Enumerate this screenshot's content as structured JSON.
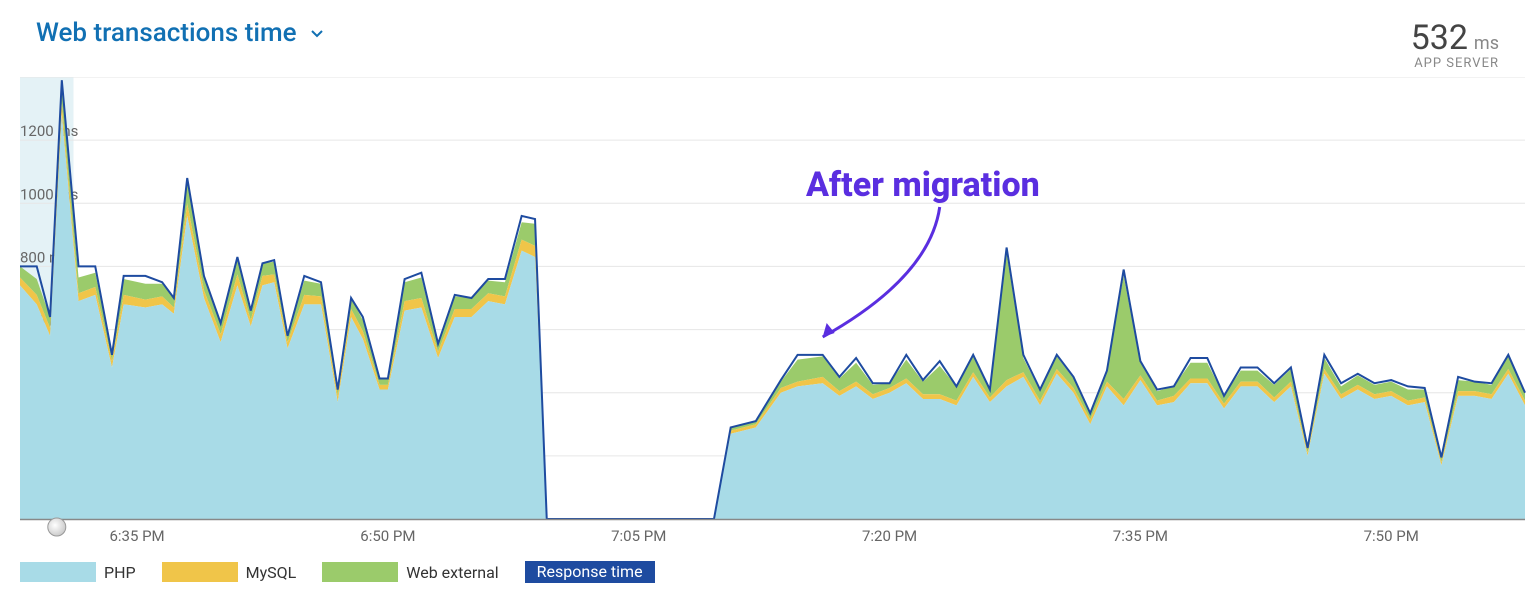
{
  "header": {
    "title": "Web transactions time",
    "metric_value": "532",
    "metric_unit": "ms",
    "metric_sub": "APP SERVER"
  },
  "annotation": {
    "text": "After migration"
  },
  "legend": {
    "php": "PHP",
    "mysql": "MySQL",
    "web": "Web external",
    "resp": "Response time"
  },
  "chart_data": {
    "type": "area",
    "title": "Web transactions time",
    "ylabel": "ms",
    "ylim": [
      0,
      1400
    ],
    "y_ticks": [
      200,
      400,
      600,
      800,
      1000,
      1200,
      1400
    ],
    "x_ticks": [
      "6:35 PM",
      "6:50 PM",
      "7:05 PM",
      "7:20 PM",
      "7:35 PM",
      "7:50 PM"
    ],
    "x_tick_minutes": [
      395,
      410,
      425,
      440,
      455,
      470
    ],
    "x_range_minutes": [
      388,
      478
    ],
    "annotation": {
      "text": "After migration",
      "at_minute": 445
    },
    "series": [
      {
        "name": "PHP",
        "color": "#a8dbe7"
      },
      {
        "name": "MySQL",
        "color": "#f0c549"
      },
      {
        "name": "Web external",
        "color": "#9bcb6b"
      },
      {
        "name": "Response time",
        "color": "#1e4ba0"
      }
    ],
    "points": [
      {
        "m": 388.0,
        "php": 740,
        "mysql": 25,
        "web": 35,
        "resp": 800
      },
      {
        "m": 389.0,
        "php": 680,
        "mysql": 30,
        "web": 50,
        "resp": 800
      },
      {
        "m": 389.8,
        "php": 580,
        "mysql": 25,
        "web": 35,
        "resp": 640
      },
      {
        "m": 390.5,
        "php": 1280,
        "mysql": 35,
        "web": 60,
        "resp": 1390
      },
      {
        "m": 391.5,
        "php": 690,
        "mysql": 25,
        "web": 50,
        "resp": 800
      },
      {
        "m": 392.5,
        "php": 710,
        "mysql": 25,
        "web": 45,
        "resp": 800
      },
      {
        "m": 393.5,
        "php": 480,
        "mysql": 20,
        "web": 25,
        "resp": 520
      },
      {
        "m": 394.2,
        "php": 680,
        "mysql": 30,
        "web": 50,
        "resp": 770
      },
      {
        "m": 395.5,
        "php": 670,
        "mysql": 25,
        "web": 50,
        "resp": 770
      },
      {
        "m": 396.5,
        "php": 680,
        "mysql": 25,
        "web": 40,
        "resp": 750
      },
      {
        "m": 397.2,
        "php": 650,
        "mysql": 20,
        "web": 30,
        "resp": 700
      },
      {
        "m": 398.0,
        "php": 960,
        "mysql": 40,
        "web": 65,
        "resp": 1080
      },
      {
        "m": 399.0,
        "php": 700,
        "mysql": 25,
        "web": 45,
        "resp": 770
      },
      {
        "m": 400.0,
        "php": 560,
        "mysql": 25,
        "web": 30,
        "resp": 620
      },
      {
        "m": 401.0,
        "php": 740,
        "mysql": 35,
        "web": 50,
        "resp": 830
      },
      {
        "m": 401.8,
        "php": 610,
        "mysql": 20,
        "web": 30,
        "resp": 660
      },
      {
        "m": 402.5,
        "php": 740,
        "mysql": 30,
        "web": 40,
        "resp": 810
      },
      {
        "m": 403.2,
        "php": 750,
        "mysql": 25,
        "web": 40,
        "resp": 820
      },
      {
        "m": 404.0,
        "php": 540,
        "mysql": 20,
        "web": 25,
        "resp": 580
      },
      {
        "m": 405.0,
        "php": 680,
        "mysql": 30,
        "web": 45,
        "resp": 770
      },
      {
        "m": 406.0,
        "php": 680,
        "mysql": 25,
        "web": 40,
        "resp": 750
      },
      {
        "m": 407.0,
        "php": 370,
        "mysql": 20,
        "web": 25,
        "resp": 410
      },
      {
        "m": 407.8,
        "php": 640,
        "mysql": 25,
        "web": 35,
        "resp": 700
      },
      {
        "m": 408.5,
        "php": 570,
        "mysql": 25,
        "web": 35,
        "resp": 640
      },
      {
        "m": 409.5,
        "php": 410,
        "mysql": 15,
        "web": 20,
        "resp": 445
      },
      {
        "m": 410.0,
        "php": 410,
        "mysql": 15,
        "web": 20,
        "resp": 445
      },
      {
        "m": 411.0,
        "php": 660,
        "mysql": 30,
        "web": 60,
        "resp": 760
      },
      {
        "m": 412.0,
        "php": 670,
        "mysql": 30,
        "web": 65,
        "resp": 780
      },
      {
        "m": 413.0,
        "php": 510,
        "mysql": 20,
        "web": 25,
        "resp": 555
      },
      {
        "m": 414.0,
        "php": 640,
        "mysql": 25,
        "web": 40,
        "resp": 710
      },
      {
        "m": 415.0,
        "php": 640,
        "mysql": 25,
        "web": 35,
        "resp": 700
      },
      {
        "m": 416.0,
        "php": 690,
        "mysql": 25,
        "web": 40,
        "resp": 760
      },
      {
        "m": 417.0,
        "php": 680,
        "mysql": 25,
        "web": 45,
        "resp": 760
      },
      {
        "m": 418.0,
        "php": 850,
        "mysql": 35,
        "web": 55,
        "resp": 960
      },
      {
        "m": 418.8,
        "php": 830,
        "mysql": 35,
        "web": 70,
        "resp": 950
      },
      {
        "m": 419.5,
        "php": 0,
        "mysql": 0,
        "web": 0,
        "resp": 0
      },
      {
        "m": 429.5,
        "php": 0,
        "mysql": 0,
        "web": 0,
        "resp": 0
      },
      {
        "m": 430.5,
        "php": 270,
        "mysql": 10,
        "web": 10,
        "resp": 290
      },
      {
        "m": 432.0,
        "php": 290,
        "mysql": 10,
        "web": 10,
        "resp": 310
      },
      {
        "m": 433.5,
        "php": 400,
        "mysql": 15,
        "web": 20,
        "resp": 440
      },
      {
        "m": 434.5,
        "php": 420,
        "mysql": 15,
        "web": 70,
        "resp": 520
      },
      {
        "m": 436.0,
        "php": 430,
        "mysql": 20,
        "web": 65,
        "resp": 520
      },
      {
        "m": 437.0,
        "php": 390,
        "mysql": 15,
        "web": 40,
        "resp": 450
      },
      {
        "m": 438.0,
        "php": 420,
        "mysql": 15,
        "web": 60,
        "resp": 510
      },
      {
        "m": 439.0,
        "php": 380,
        "mysql": 15,
        "web": 30,
        "resp": 430
      },
      {
        "m": 440.0,
        "php": 400,
        "mysql": 15,
        "web": 15,
        "resp": 430
      },
      {
        "m": 441.0,
        "php": 430,
        "mysql": 15,
        "web": 60,
        "resp": 520
      },
      {
        "m": 442.0,
        "php": 380,
        "mysql": 15,
        "web": 40,
        "resp": 440
      },
      {
        "m": 443.0,
        "php": 380,
        "mysql": 15,
        "web": 90,
        "resp": 500
      },
      {
        "m": 444.0,
        "php": 360,
        "mysql": 15,
        "web": 45,
        "resp": 420
      },
      {
        "m": 445.0,
        "php": 450,
        "mysql": 15,
        "web": 50,
        "resp": 520
      },
      {
        "m": 446.0,
        "php": 370,
        "mysql": 15,
        "web": 25,
        "resp": 410
      },
      {
        "m": 447.0,
        "php": 420,
        "mysql": 20,
        "web": 400,
        "resp": 860
      },
      {
        "m": 448.0,
        "php": 450,
        "mysql": 15,
        "web": 45,
        "resp": 520
      },
      {
        "m": 449.0,
        "php": 360,
        "mysql": 15,
        "web": 30,
        "resp": 410
      },
      {
        "m": 450.0,
        "php": 460,
        "mysql": 15,
        "web": 40,
        "resp": 520
      },
      {
        "m": 451.0,
        "php": 400,
        "mysql": 15,
        "web": 30,
        "resp": 450
      },
      {
        "m": 452.0,
        "php": 300,
        "mysql": 15,
        "web": 20,
        "resp": 335
      },
      {
        "m": 453.0,
        "php": 420,
        "mysql": 15,
        "web": 35,
        "resp": 470
      },
      {
        "m": 454.0,
        "php": 360,
        "mysql": 20,
        "web": 390,
        "resp": 790
      },
      {
        "m": 455.0,
        "php": 440,
        "mysql": 15,
        "web": 40,
        "resp": 500
      },
      {
        "m": 456.0,
        "php": 360,
        "mysql": 15,
        "web": 30,
        "resp": 410
      },
      {
        "m": 457.0,
        "php": 370,
        "mysql": 20,
        "web": 30,
        "resp": 420
      },
      {
        "m": 458.0,
        "php": 430,
        "mysql": 15,
        "web": 50,
        "resp": 510
      },
      {
        "m": 459.0,
        "php": 430,
        "mysql": 15,
        "web": 50,
        "resp": 510
      },
      {
        "m": 460.0,
        "php": 350,
        "mysql": 15,
        "web": 25,
        "resp": 390
      },
      {
        "m": 461.0,
        "php": 420,
        "mysql": 15,
        "web": 35,
        "resp": 480
      },
      {
        "m": 462.0,
        "php": 420,
        "mysql": 15,
        "web": 35,
        "resp": 480
      },
      {
        "m": 463.0,
        "php": 370,
        "mysql": 15,
        "web": 40,
        "resp": 430
      },
      {
        "m": 464.0,
        "php": 420,
        "mysql": 15,
        "web": 40,
        "resp": 480
      },
      {
        "m": 465.0,
        "php": 200,
        "mysql": 10,
        "web": 15,
        "resp": 225
      },
      {
        "m": 466.0,
        "php": 460,
        "mysql": 15,
        "web": 35,
        "resp": 520
      },
      {
        "m": 467.0,
        "php": 380,
        "mysql": 15,
        "web": 25,
        "resp": 430
      },
      {
        "m": 468.0,
        "php": 410,
        "mysql": 15,
        "web": 30,
        "resp": 460
      },
      {
        "m": 469.0,
        "php": 380,
        "mysql": 15,
        "web": 30,
        "resp": 430
      },
      {
        "m": 470.0,
        "php": 390,
        "mysql": 15,
        "web": 30,
        "resp": 440
      },
      {
        "m": 471.0,
        "php": 360,
        "mysql": 15,
        "web": 35,
        "resp": 420
      },
      {
        "m": 472.0,
        "php": 370,
        "mysql": 15,
        "web": 25,
        "resp": 415
      },
      {
        "m": 473.0,
        "php": 170,
        "mysql": 10,
        "web": 15,
        "resp": 195
      },
      {
        "m": 474.0,
        "php": 390,
        "mysql": 15,
        "web": 35,
        "resp": 450
      },
      {
        "m": 475.0,
        "php": 390,
        "mysql": 15,
        "web": 30,
        "resp": 435
      },
      {
        "m": 476.0,
        "php": 380,
        "mysql": 15,
        "web": 30,
        "resp": 430
      },
      {
        "m": 477.0,
        "php": 460,
        "mysql": 15,
        "web": 40,
        "resp": 520
      },
      {
        "m": 478.0,
        "php": 360,
        "mysql": 15,
        "web": 25,
        "resp": 400
      }
    ]
  }
}
